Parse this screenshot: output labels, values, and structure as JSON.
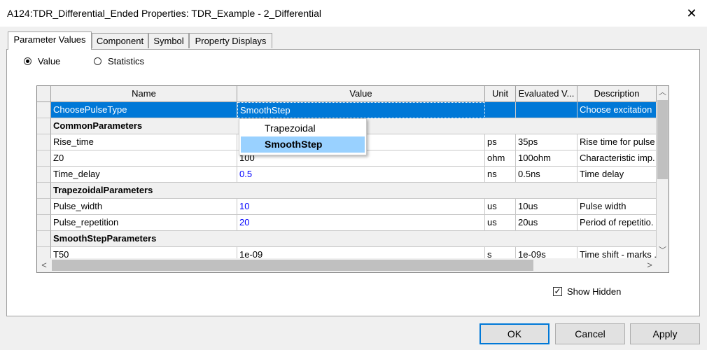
{
  "window": {
    "title": "A124:TDR_Differential_Ended Properties: TDR_Example - 2_Differential",
    "close_glyph": "✕"
  },
  "tabs": [
    "Parameter Values",
    "Component",
    "Symbol",
    "Property Displays"
  ],
  "view_mode": {
    "value_label": "Value",
    "statistics_label": "Statistics",
    "selected": "Value"
  },
  "table": {
    "columns": [
      "Name",
      "Value",
      "Unit",
      "Evaluated V...",
      "Description"
    ],
    "rows": [
      {
        "name": "ChoosePulseType",
        "value": "SmoothStep",
        "unit": "",
        "evaluated": "",
        "description": "Choose excitation"
      },
      {
        "name": "CommonParameters",
        "value": "",
        "unit": "",
        "evaluated": "",
        "description": ""
      },
      {
        "name": "Rise_time",
        "value": "",
        "unit": "ps",
        "evaluated": "35ps",
        "description": "Rise time for pulse"
      },
      {
        "name": "Z0",
        "value": "100",
        "unit": "ohm",
        "evaluated": "100ohm",
        "description": "Characteristic imp."
      },
      {
        "name": "Time_delay",
        "value": "0.5",
        "unit": "ns",
        "evaluated": "0.5ns",
        "description": "Time delay"
      },
      {
        "name": "TrapezoidalParameters",
        "value": "",
        "unit": "",
        "evaluated": "",
        "description": ""
      },
      {
        "name": "Pulse_width",
        "value": "10",
        "unit": "us",
        "evaluated": "10us",
        "description": "Pulse width"
      },
      {
        "name": "Pulse_repetition",
        "value": "20",
        "unit": "us",
        "evaluated": "20us",
        "description": "Period of repetitio."
      },
      {
        "name": "SmoothStepParameters",
        "value": "",
        "unit": "",
        "evaluated": "",
        "description": ""
      },
      {
        "name": "T50",
        "value": "1e-09",
        "unit": "s",
        "evaluated": "1e-09s",
        "description": "Time shift - marks ."
      }
    ]
  },
  "dropdown": {
    "options": [
      "Trapezoidal",
      "SmoothStep"
    ],
    "selected": "SmoothStep"
  },
  "scroll": {
    "up": "︿",
    "down": "﹀",
    "left": "<",
    "right": ">"
  },
  "show_hidden": {
    "label": "Show Hidden",
    "checked": true,
    "check_glyph": "✓"
  },
  "buttons": {
    "ok": "OK",
    "cancel": "Cancel",
    "apply": "Apply"
  },
  "colors": {
    "selection": "#0078d7",
    "dropdown_highlight": "#99d1ff",
    "editable_value": "#0000ff"
  }
}
